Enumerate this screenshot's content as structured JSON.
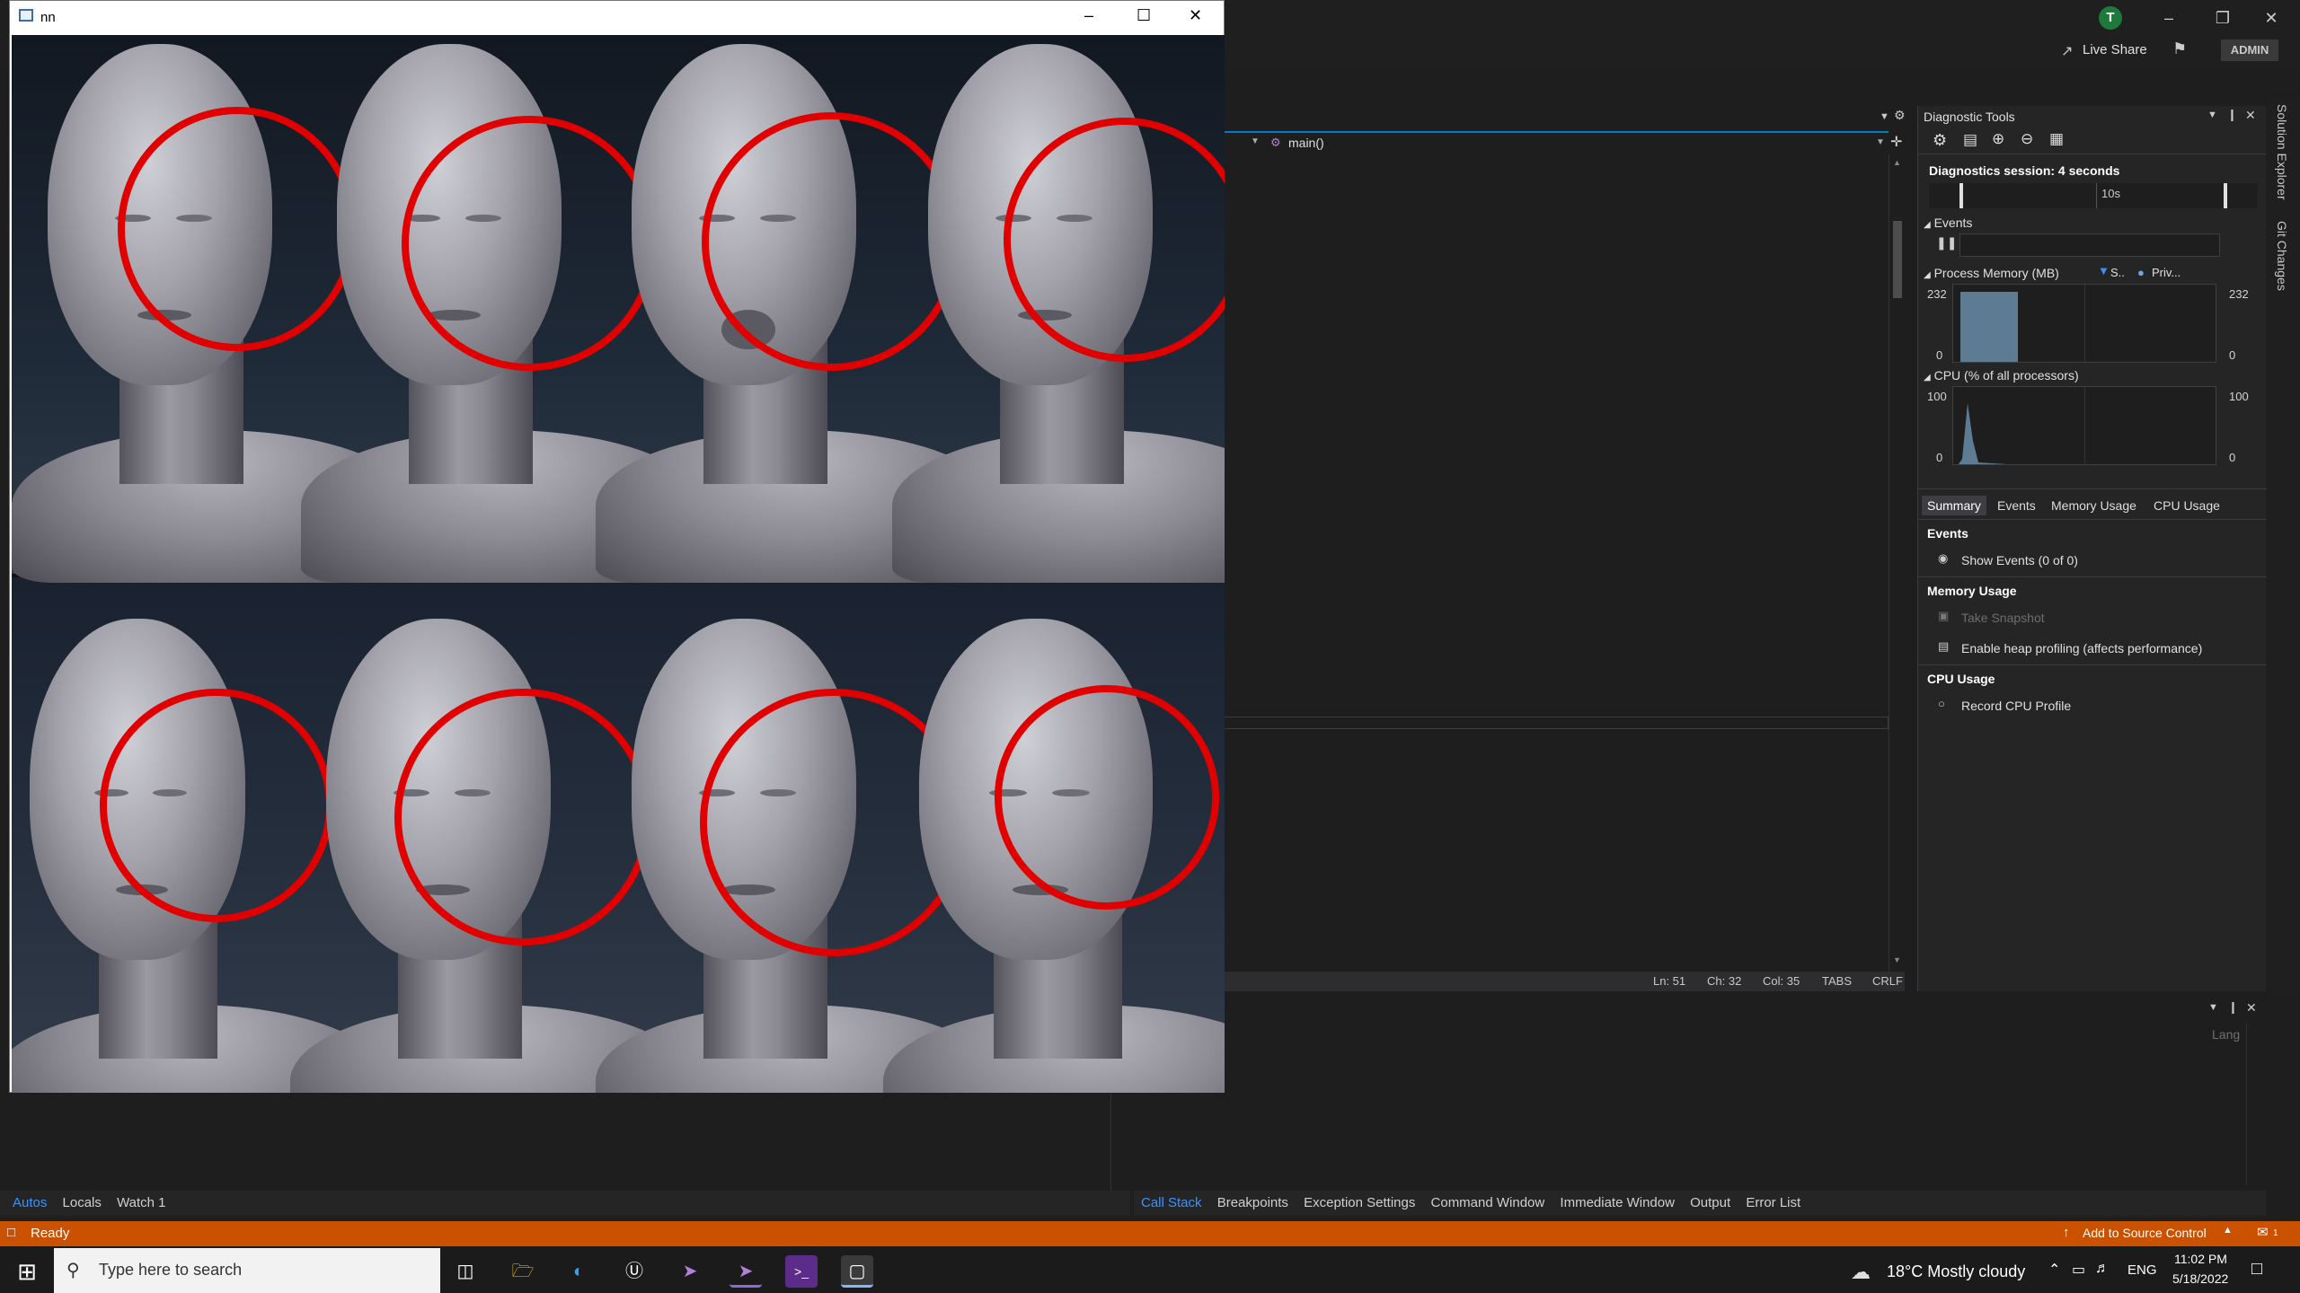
{
  "vs": {
    "avatar_letter": "T",
    "live_share": "Live Share",
    "admin": "ADMIN",
    "nav_function": "main()",
    "editor_status": {
      "ln": "Ln: 51",
      "ch": "Ch: 32",
      "col": "Col: 35",
      "tabs": "TABS",
      "eol": "CRLF"
    },
    "lang_label": "Lang"
  },
  "diagnostics": {
    "title": "Diagnostic Tools",
    "session": "Diagnostics session: 4 seconds",
    "timeline_label": "10s",
    "events_header": "Events",
    "memory_header": "Process Memory (MB)",
    "memory_legend": [
      "S..",
      "Priv..."
    ],
    "memory_max": "232",
    "memory_min": "0",
    "cpu_header": "CPU (% of all processors)",
    "cpu_max": "100",
    "cpu_min": "0",
    "tabs": [
      "Summary",
      "Events",
      "Memory Usage",
      "CPU Usage"
    ],
    "summary": {
      "events_title": "Events",
      "show_events": "Show Events (0 of 0)",
      "memory_title": "Memory Usage",
      "take_snapshot": "Take Snapshot",
      "heap_profiling": "Enable heap profiling (affects performance)",
      "cpu_title": "CPU Usage",
      "record_cpu": "Record CPU Profile"
    }
  },
  "side_tabs": [
    "Solution Explorer",
    "Git Changes"
  ],
  "bottom_left_tabs": [
    "Autos",
    "Locals",
    "Watch 1"
  ],
  "bottom_right_tabs": [
    "Call Stack",
    "Breakpoints",
    "Exception Settings",
    "Command Window",
    "Immediate Window",
    "Output",
    "Error List"
  ],
  "status": {
    "ready": "Ready",
    "source_control": "Add to Source Control",
    "notification_count": "1"
  },
  "taskbar": {
    "search_placeholder": "Type here to search",
    "weather": "18°C  Mostly cloudy",
    "lang": "ENG",
    "time": "11:02 PM",
    "date": "5/18/2022"
  },
  "app_window": {
    "title": "nn"
  },
  "colors": {
    "accent": "#007acc",
    "status_bar": "#ca5100",
    "ring": "#e00000"
  }
}
